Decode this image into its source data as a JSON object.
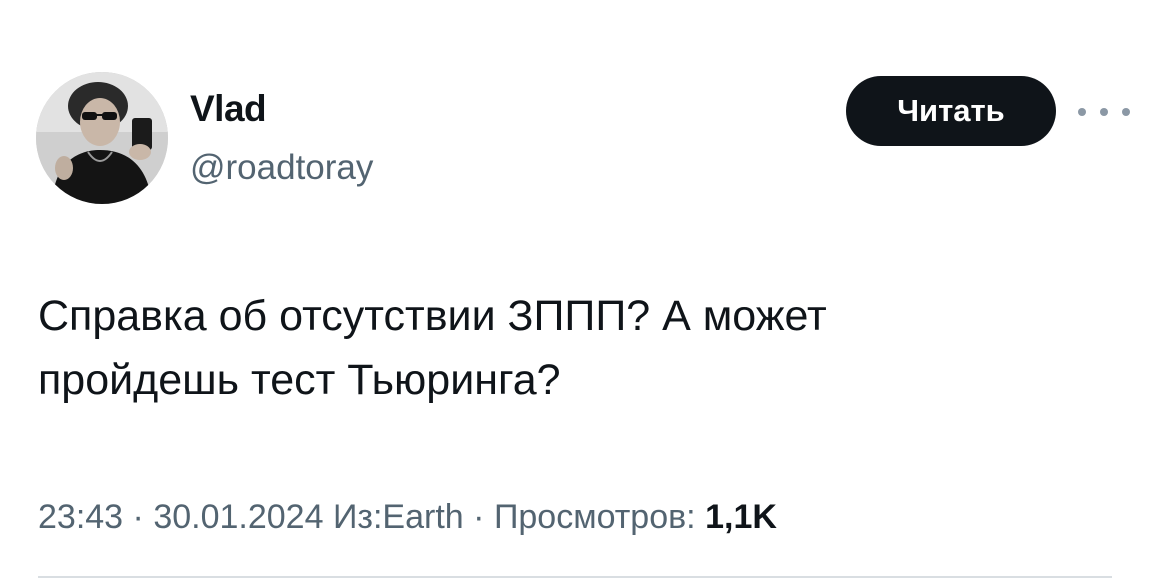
{
  "author": {
    "display_name": "Vlad",
    "handle": "@roadtoray",
    "avatar_icon": "avatar-photo"
  },
  "actions": {
    "follow_label": "Читать",
    "more_icon": "more-dots-icon"
  },
  "tweet": {
    "text_line1": "Справка об отсутствии ЗППП? А может",
    "text_line2": "пройдешь тест Тьюринга?"
  },
  "meta": {
    "time": "23:43",
    "separator": "·",
    "date": "30.01.2024",
    "location": "Из:Earth",
    "views_label": "Просмотров:",
    "views_count": "1,1K"
  },
  "colors": {
    "text": "#0f1419",
    "secondary": "#536471",
    "button_bg": "#0f1419"
  }
}
